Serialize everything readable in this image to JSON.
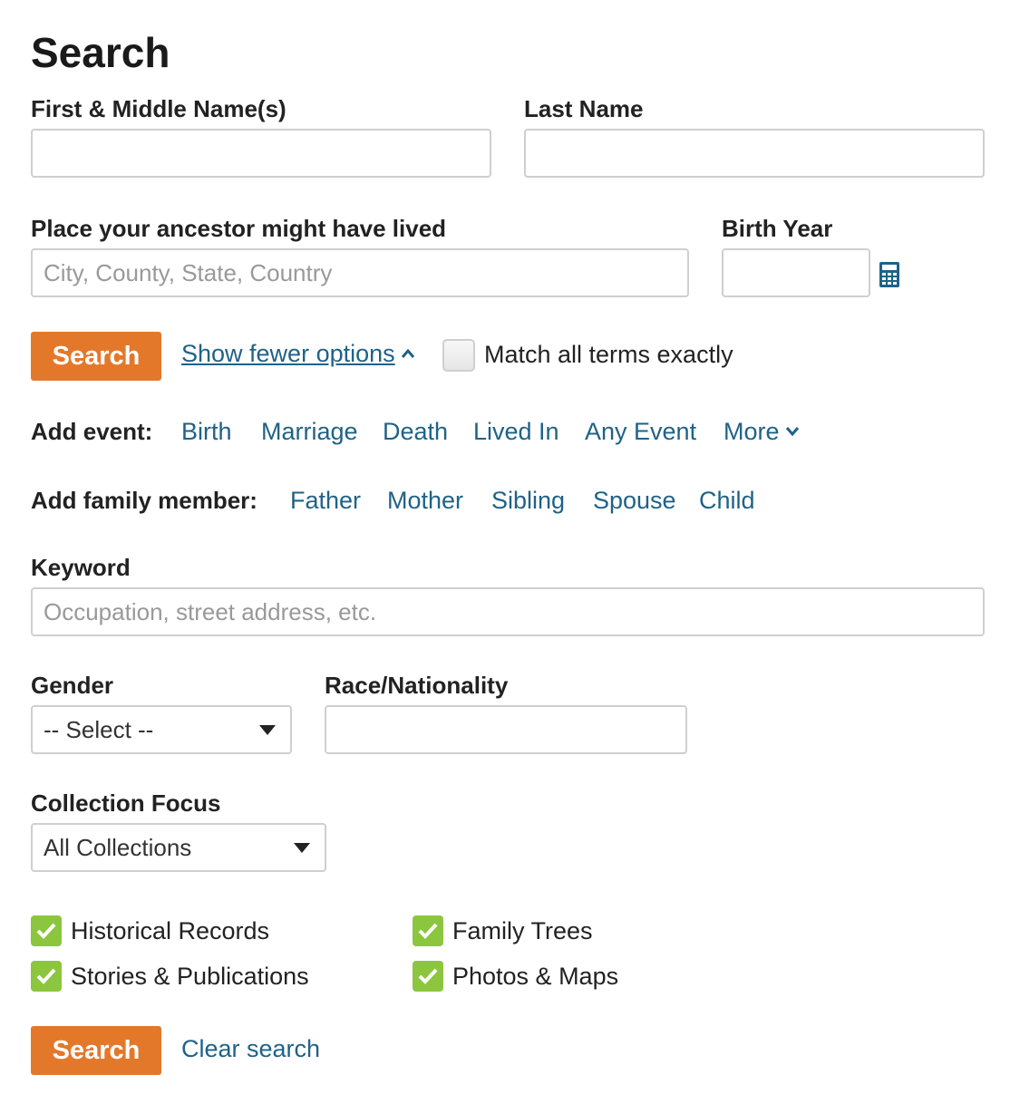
{
  "page_title": "Search",
  "labels": {
    "first_name": "First & Middle Name(s)",
    "last_name": "Last Name",
    "place": "Place your ancestor might have lived",
    "birth_year": "Birth Year",
    "keyword": "Keyword",
    "gender": "Gender",
    "race": "Race/Nationality",
    "collection_focus": "Collection Focus"
  },
  "inputs": {
    "first_name_value": "",
    "last_name_value": "",
    "place_placeholder": "City, County, State, Country",
    "birth_year_value": "",
    "keyword_placeholder": "Occupation, street address, etc.",
    "race_value": ""
  },
  "actions": {
    "search_label": "Search",
    "show_fewer": "Show fewer options",
    "match_exact": "Match all terms exactly",
    "clear_search": "Clear search"
  },
  "add_event": {
    "label": "Add event:",
    "items": [
      "Birth",
      "Marriage",
      "Death",
      "Lived In",
      "Any Event"
    ],
    "more": "More"
  },
  "add_family": {
    "label": "Add family member:",
    "items": [
      "Father",
      "Mother",
      "Sibling",
      "Spouse",
      "Child"
    ]
  },
  "selects": {
    "gender_selected": "-- Select --",
    "collection_selected": "All Collections"
  },
  "checkboxes": [
    {
      "label": "Historical Records",
      "checked": true
    },
    {
      "label": "Family Trees",
      "checked": true
    },
    {
      "label": "Stories & Publications",
      "checked": true
    },
    {
      "label": "Photos & Maps",
      "checked": true
    }
  ],
  "colors": {
    "accent": "#e4782a",
    "link": "#1f6287",
    "checkbox": "#8cc63f"
  },
  "icons": {
    "calculator": "calculator-icon",
    "chevron_up": "chevron-up-icon",
    "chevron_down": "chevron-down-icon",
    "checkmark": "checkmark-icon"
  }
}
